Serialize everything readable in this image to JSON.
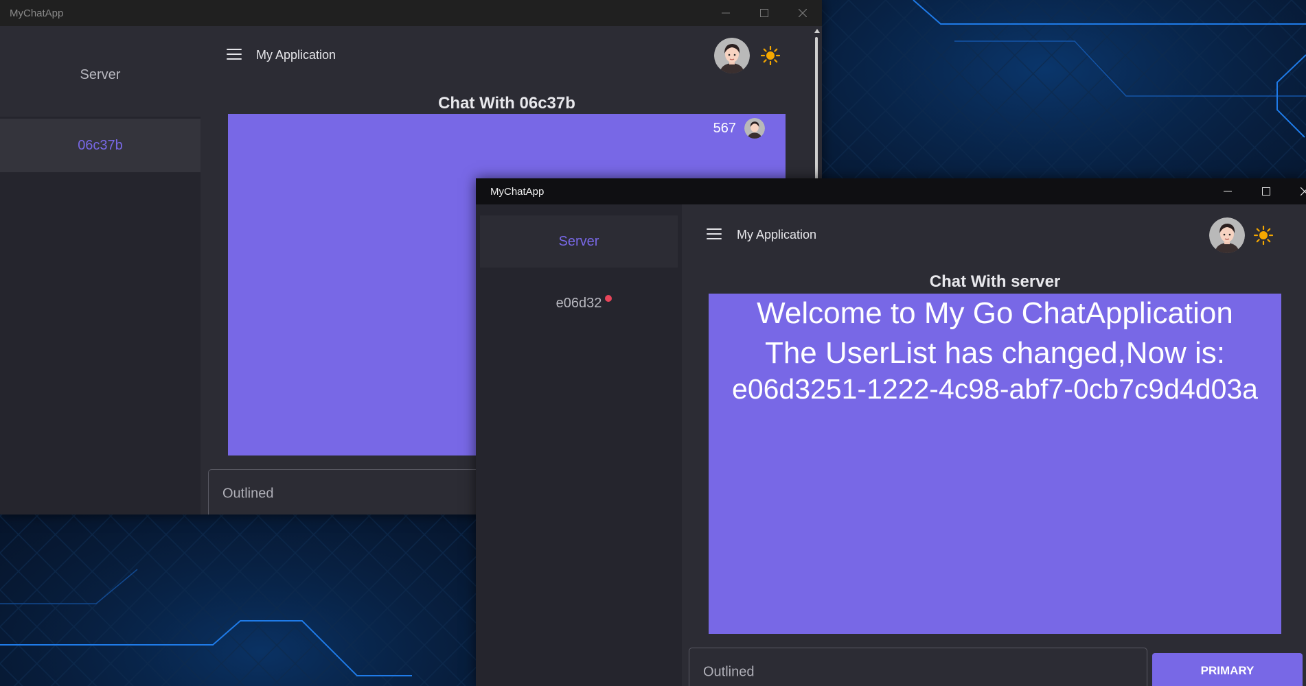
{
  "colors": {
    "accent": "#7868e6",
    "unread_dot": "#e8455a",
    "sun": "#f5a800",
    "window_bg": "#2c2c34",
    "sidebar_bg": "#25252d"
  },
  "back_window": {
    "app_title": "MyChatApp",
    "header_title": "My Application",
    "sidebar": {
      "items": [
        {
          "label": "Server",
          "selected": false
        },
        {
          "label": "06c37b",
          "selected": true
        }
      ]
    },
    "chat_title": "Chat With 06c37b",
    "message": {
      "text": "567",
      "avatar_icon": "user-avatar-icon"
    },
    "input": {
      "placeholder": "Outlined"
    }
  },
  "front_window": {
    "app_title": "MyChatApp",
    "header_title": "My Application",
    "sidebar": {
      "items": [
        {
          "label": "Server",
          "selected": true
        },
        {
          "label": "e06d32",
          "selected": false,
          "unread_dot": true
        }
      ]
    },
    "chat_title": "Chat With server",
    "messages": [
      "Welcome to My Go ChatApplication",
      "The UserList has changed,Now is:",
      "e06d3251-1222-4c98-abf7-0cb7c9d4d03a"
    ],
    "input": {
      "placeholder": "Outlined"
    },
    "send_button": "PRIMARY"
  }
}
